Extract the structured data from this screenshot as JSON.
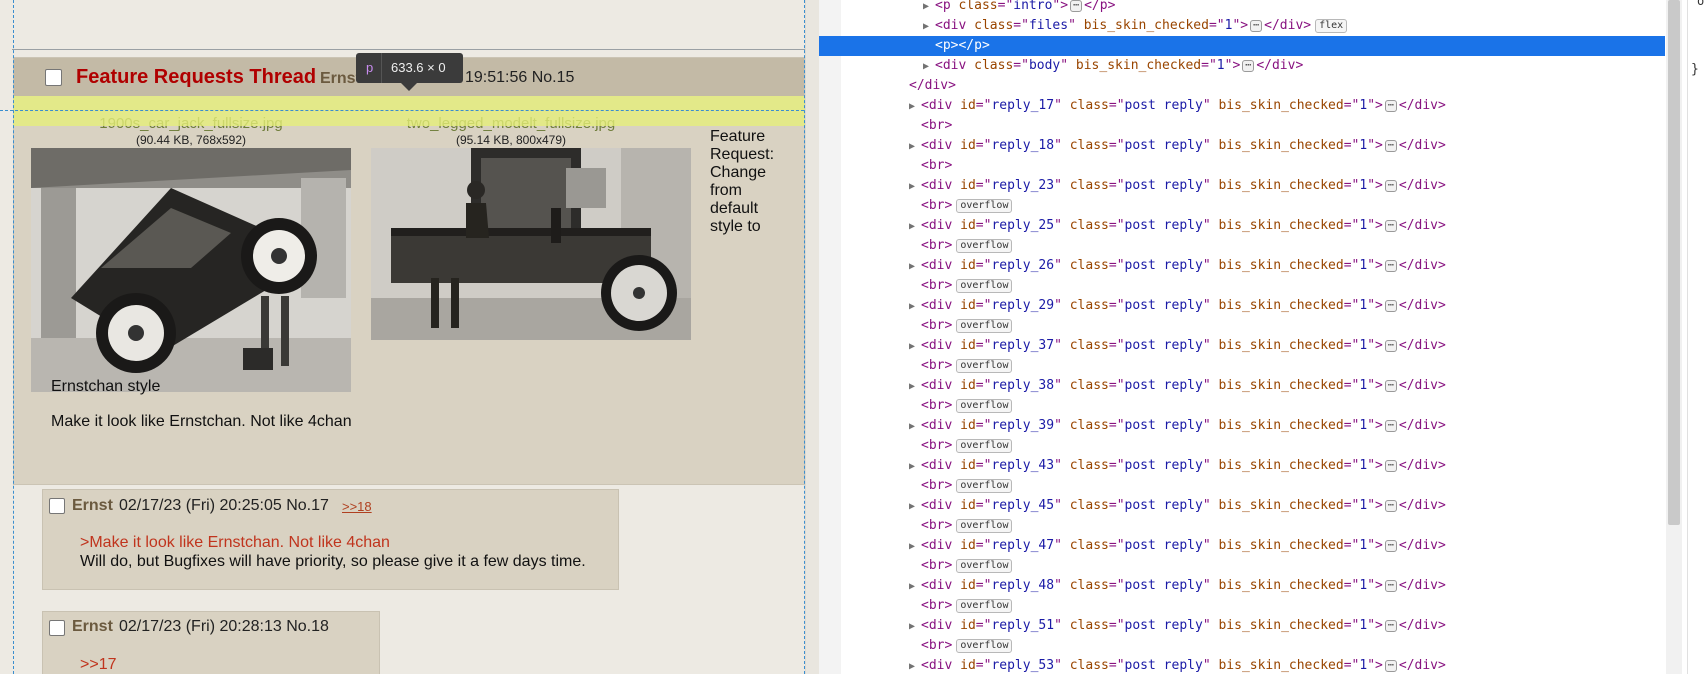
{
  "tooltip": {
    "tag": "p",
    "size": "633.6 × 0"
  },
  "op": {
    "title": "Feature Requests Thread",
    "name": "Ernst",
    "datetime_visible": "19:51:56 No.15",
    "files": [
      {
        "name": "1900s_car_jack_fullsize.jpg",
        "meta": "(90.44 KB, 768x592)",
        "icon": "car-jack-photo"
      },
      {
        "name": "two_legged_modelt_fullsize.jpg",
        "meta": "(95.14 KB, 800x479)",
        "icon": "model-t-truck-photo"
      }
    ],
    "body_side": "Feature Request: Change from default style to",
    "body_line1": "Ernstchan style",
    "body_line2": "Make it look like Ernstchan. Not like 4chan"
  },
  "replies": [
    {
      "name": "Ernst",
      "datetime": "02/17/23 (Fri) 20:25:05 No.17",
      "backlink": ">>18",
      "quote": ">Make it look like Ernstchan. Not like 4chan",
      "text": "Will do, but Bugfixes will have priority, so please give it a few days time."
    },
    {
      "name": "Ernst",
      "datetime": "02/17/23 (Fri) 20:28:13 No.18",
      "quote": ">>17"
    }
  ],
  "devtools": {
    "rows": [
      {
        "kind": "p-intro",
        "indent": 1
      },
      {
        "kind": "div-files",
        "indent": 1,
        "class": "files",
        "attr": "bis_skin_checked",
        "val": "1",
        "badge": "flex"
      },
      {
        "kind": "p-empty",
        "indent": 1,
        "selected": true
      },
      {
        "kind": "div-body",
        "indent": 1,
        "class": "body",
        "attr": "bis_skin_checked",
        "val": "1"
      },
      {
        "kind": "close-div",
        "indent": 0
      },
      {
        "kind": "reply",
        "id": "reply_17"
      },
      {
        "kind": "br"
      },
      {
        "kind": "reply",
        "id": "reply_18"
      },
      {
        "kind": "br"
      },
      {
        "kind": "reply",
        "id": "reply_23"
      },
      {
        "kind": "br",
        "badge": "overflow"
      },
      {
        "kind": "reply",
        "id": "reply_25"
      },
      {
        "kind": "br",
        "badge": "overflow"
      },
      {
        "kind": "reply",
        "id": "reply_26"
      },
      {
        "kind": "br",
        "badge": "overflow"
      },
      {
        "kind": "reply",
        "id": "reply_29"
      },
      {
        "kind": "br",
        "badge": "overflow"
      },
      {
        "kind": "reply",
        "id": "reply_37"
      },
      {
        "kind": "br",
        "badge": "overflow"
      },
      {
        "kind": "reply",
        "id": "reply_38"
      },
      {
        "kind": "br",
        "badge": "overflow"
      },
      {
        "kind": "reply",
        "id": "reply_39"
      },
      {
        "kind": "br",
        "badge": "overflow"
      },
      {
        "kind": "reply",
        "id": "reply_43"
      },
      {
        "kind": "br",
        "badge": "overflow"
      },
      {
        "kind": "reply",
        "id": "reply_45"
      },
      {
        "kind": "br",
        "badge": "overflow"
      },
      {
        "kind": "reply",
        "id": "reply_47"
      },
      {
        "kind": "br",
        "badge": "overflow"
      },
      {
        "kind": "reply",
        "id": "reply_48"
      },
      {
        "kind": "br",
        "badge": "overflow"
      },
      {
        "kind": "reply",
        "id": "reply_51"
      },
      {
        "kind": "br",
        "badge": "overflow"
      },
      {
        "kind": "reply",
        "id": "reply_53"
      }
    ],
    "reply_class": "post reply",
    "attr": "bis_skin_checked",
    "attr_val": "1",
    "brace": "}",
    "corner": "o"
  },
  "colors": {
    "selected_row": "#1a73e8",
    "op_title": "#b00000",
    "quote": "#c0341d",
    "post_bg": "#d9d2c2",
    "highlight": "#e6f078"
  }
}
